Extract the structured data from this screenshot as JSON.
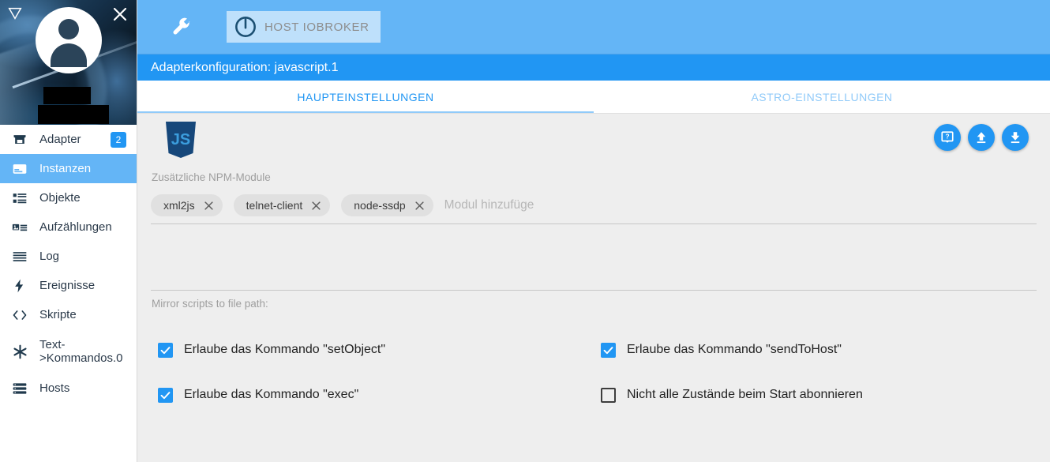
{
  "sidebar": {
    "header": {
      "caret_icon": "triangle-down-icon",
      "close_icon": "close-icon",
      "avatar_icon": "user-avatar-icon",
      "redacted_line_1": "",
      "redacted_line_2": ""
    },
    "items": [
      {
        "label": "Adapter",
        "icon": "store-icon",
        "badge": "2",
        "active": false
      },
      {
        "label": "Instanzen",
        "icon": "instances-icon",
        "badge": "",
        "active": true
      },
      {
        "label": "Objekte",
        "icon": "list-icon",
        "badge": "",
        "active": false
      },
      {
        "label": "Aufzählungen",
        "icon": "enum-icon",
        "badge": "",
        "active": false
      },
      {
        "label": "Log",
        "icon": "log-lines-icon",
        "badge": "",
        "active": false
      },
      {
        "label": "Ereignisse",
        "icon": "bolt-icon",
        "badge": "",
        "active": false
      },
      {
        "label": "Skripte",
        "icon": "code-icon",
        "badge": "",
        "active": false
      },
      {
        "label": "Text->Kommandos.0",
        "icon": "asterisk-icon",
        "badge": "",
        "active": false
      },
      {
        "label": "Hosts",
        "icon": "server-icon",
        "badge": "",
        "active": false
      }
    ]
  },
  "topbar": {
    "wrench_icon": "wrench-icon",
    "host_button": {
      "icon": "power-info-icon",
      "label": "HOST IOBROKER"
    }
  },
  "config": {
    "title": "Adapterkonfiguration: javascript.1",
    "tabs": [
      {
        "label": "HAUPTEINSTELLUNGEN",
        "active": true
      },
      {
        "label": "ASTRO-EINSTELLUNGEN",
        "active": false
      }
    ],
    "adapter_icon": "javascript-logo-icon",
    "action_buttons": [
      {
        "icon": "help-icon",
        "name": "help-button"
      },
      {
        "icon": "upload-icon",
        "name": "upload-button"
      },
      {
        "icon": "download-icon",
        "name": "download-button"
      }
    ],
    "npm": {
      "label": "Zusätzliche NPM-Module",
      "chips": [
        {
          "label": "xml2js"
        },
        {
          "label": "telnet-client"
        },
        {
          "label": "node-ssdp"
        }
      ],
      "input_value": "",
      "input_placeholder": "Modul hinzufüge"
    },
    "mirror_label": "Mirror scripts to file path:",
    "checkboxes_left": [
      {
        "label": "Erlaube das Kommando \"setObject\"",
        "checked": true
      },
      {
        "label": "Erlaube das Kommando \"exec\"",
        "checked": true
      }
    ],
    "checkboxes_right": [
      {
        "label": "Erlaube das Kommando \"sendToHost\"",
        "checked": true
      },
      {
        "label": "Nicht alle Zustände beim Start abonnieren",
        "checked": false
      }
    ]
  },
  "colors": {
    "topbar_blue": "#64b5f6",
    "header_blue": "#2196f3",
    "accent": "#2196f3",
    "content_bg": "#eeeeee"
  }
}
